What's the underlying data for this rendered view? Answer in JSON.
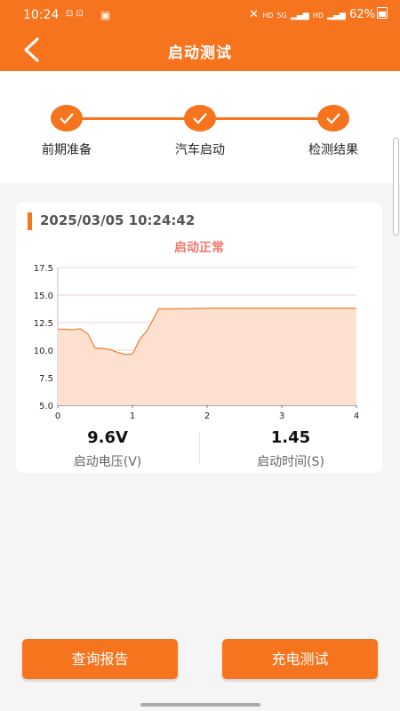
{
  "status_bar": {
    "time": "10:24",
    "network_1": "HD",
    "network_2": "HD",
    "signal_gen": "5G",
    "battery": "62%"
  },
  "header": {
    "title": "启动测试"
  },
  "steps": [
    {
      "label": "前期准备",
      "done": true
    },
    {
      "label": "汽车启动",
      "done": true
    },
    {
      "label": "检测结果",
      "done": true
    }
  ],
  "result": {
    "timestamp": "2025/03/05 10:24:42",
    "status": "启动正常",
    "voltage_value": "9.6V",
    "voltage_label": "启动电压(V)",
    "time_value": "1.45",
    "time_label": "启动时间(S)"
  },
  "chart_data": {
    "type": "area",
    "x": [
      0,
      0.1,
      0.2,
      0.3,
      0.4,
      0.5,
      0.6,
      0.7,
      0.8,
      0.9,
      1.0,
      1.1,
      1.2,
      1.35,
      1.6,
      2.0,
      2.5,
      3.0,
      3.5,
      4.0
    ],
    "y": [
      11.9,
      11.9,
      11.85,
      11.95,
      11.5,
      10.2,
      10.15,
      10.05,
      9.8,
      9.6,
      9.65,
      11.0,
      11.8,
      13.75,
      13.75,
      13.8,
      13.8,
      13.8,
      13.8,
      13.8
    ],
    "xlim": [
      0,
      4
    ],
    "ylim": [
      5.0,
      17.5
    ],
    "xticks": [
      "0",
      "1",
      "2",
      "3",
      "4"
    ],
    "yticks": [
      "5.0",
      "7.5",
      "10.0",
      "12.5",
      "15.0",
      "17.5"
    ],
    "grid": true,
    "colors": {
      "line": "#f47a2c",
      "fill": "#fde0d0",
      "grid": "#c97a6f"
    }
  },
  "buttons": {
    "report": "查询报告",
    "charge_test": "充电测试"
  }
}
